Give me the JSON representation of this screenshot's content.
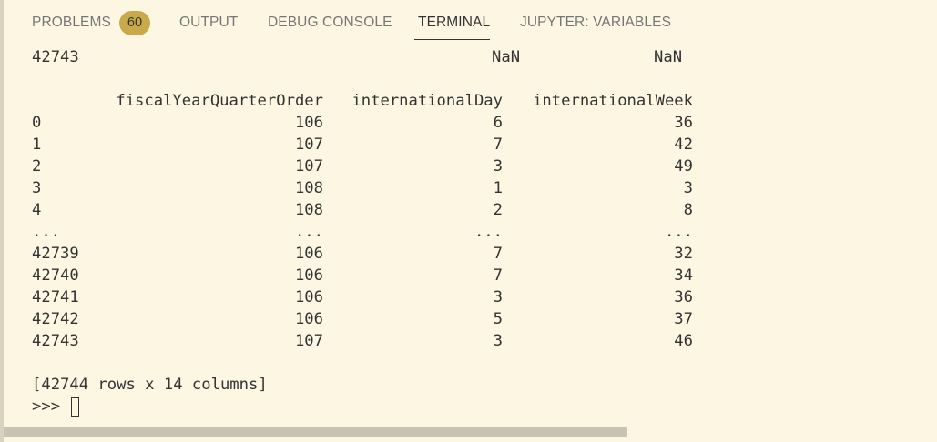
{
  "panel": {
    "tabs": [
      {
        "label": "PROBLEMS",
        "active": false
      },
      {
        "label": "OUTPUT",
        "active": false
      },
      {
        "label": "DEBUG CONSOLE",
        "active": false
      },
      {
        "label": "TERMINAL",
        "active": true
      },
      {
        "label": "JUPYTER: VARIABLES",
        "active": false
      }
    ],
    "problems_count": "60"
  },
  "terminal": {
    "prev_row": {
      "index": "42743",
      "col_a": "NaN",
      "col_b": "NaN"
    },
    "headers": [
      "fiscalYearQuarterOrder",
      "internationalDay",
      "internationalWeek"
    ],
    "rows": [
      [
        "0",
        "106",
        "6",
        "36"
      ],
      [
        "1",
        "107",
        "7",
        "42"
      ],
      [
        "2",
        "107",
        "3",
        "49"
      ],
      [
        "3",
        "108",
        "1",
        "3"
      ],
      [
        "4",
        "108",
        "2",
        "8"
      ],
      [
        "...",
        "...",
        "...",
        "..."
      ],
      [
        "42739",
        "106",
        "7",
        "32"
      ],
      [
        "42740",
        "106",
        "7",
        "34"
      ],
      [
        "42741",
        "106",
        "3",
        "36"
      ],
      [
        "42742",
        "106",
        "5",
        "37"
      ],
      [
        "42743",
        "107",
        "3",
        "46"
      ]
    ],
    "summary": "[42744 rows x 14 columns]",
    "prompt": ">>>"
  },
  "colors": {
    "background": "#fdf6e3",
    "badge": "#c9a948",
    "text": "#333333",
    "inactive_tab": "#767676"
  }
}
